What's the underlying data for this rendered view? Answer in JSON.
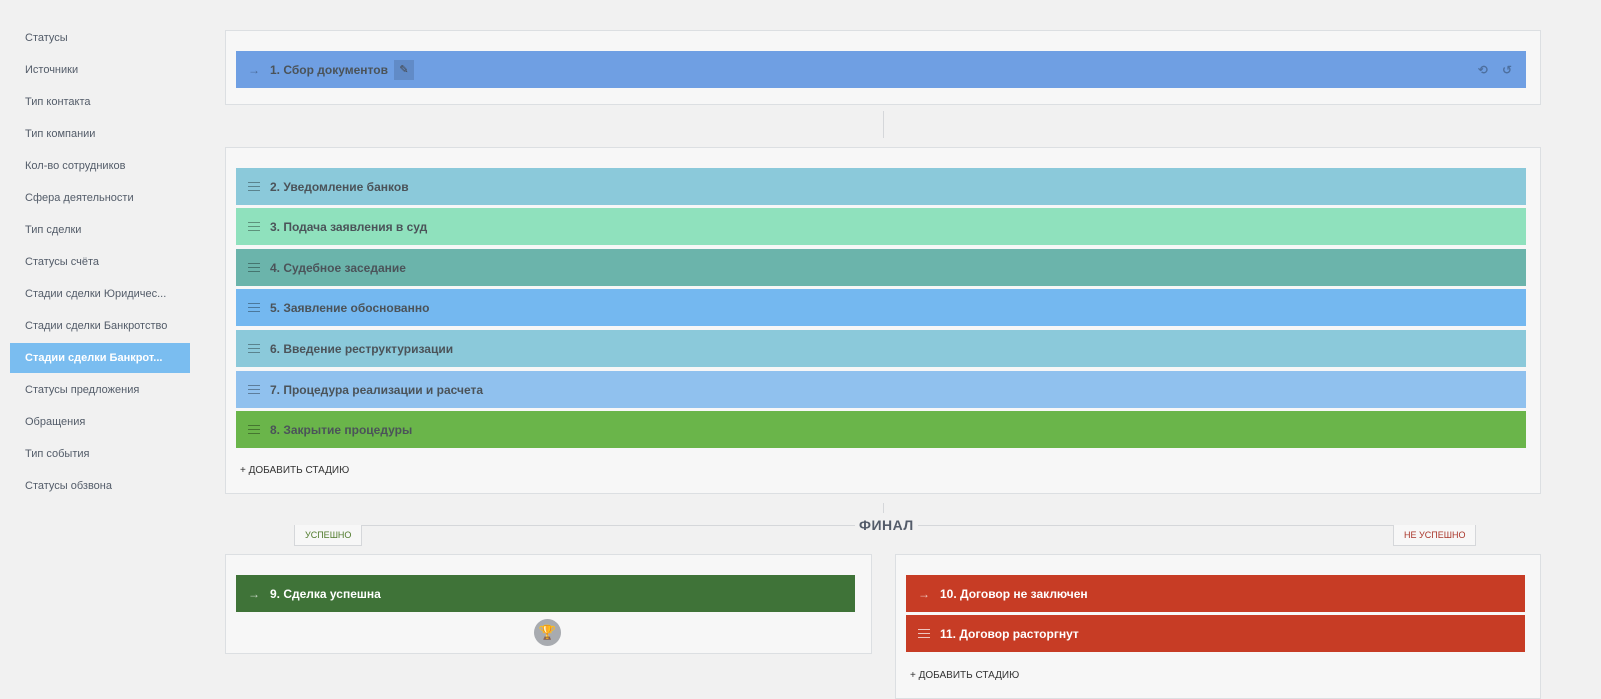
{
  "sidebar": {
    "items": [
      {
        "label": "Статусы"
      },
      {
        "label": "Источники"
      },
      {
        "label": "Тип контакта"
      },
      {
        "label": "Тип компании"
      },
      {
        "label": "Кол-во сотрудников"
      },
      {
        "label": "Сфера деятельности"
      },
      {
        "label": "Тип сделки"
      },
      {
        "label": "Статусы счёта"
      },
      {
        "label": "Стадии сделки Юридичес..."
      },
      {
        "label": "Стадии сделки Банкротство"
      },
      {
        "label": "Стадии сделки Банкрот...",
        "active": true
      },
      {
        "label": "Статусы предложения"
      },
      {
        "label": "Обращения"
      },
      {
        "label": "Тип события"
      },
      {
        "label": "Статусы обзвона"
      }
    ]
  },
  "first_stage": {
    "label": "1. Сбор документов",
    "color": "#6f9fe3"
  },
  "stages": [
    {
      "label": "2. Уведомление банков",
      "color": "#8bc9da"
    },
    {
      "label": "3. Подача заявления в суд",
      "color": "#8fe1bd"
    },
    {
      "label": "4. Судебное заседание",
      "color": "#6bb4ab"
    },
    {
      "label": "5. Заявление обоснованно",
      "color": "#74b8f0"
    },
    {
      "label": "6. Введение реструктуризации",
      "color": "#8bc9da"
    },
    {
      "label": "7. Процедура реализации и расчета",
      "color": "#90c1ee"
    },
    {
      "label": "8. Закрытие процедуры",
      "color": "#6ab54a"
    }
  ],
  "add_stage_label": "+ ДОБАВИТЬ СТАДИЮ",
  "final": {
    "title": "ФИНАЛ",
    "success_tab": "УСПЕШНО",
    "fail_tab": "НЕ УСПЕШНО",
    "success_stage": {
      "label": "9. Сделка успешна",
      "color": "#3f7338"
    },
    "fail_stages": [
      {
        "label": "10. Договор не заключен",
        "color": "#c73c25"
      },
      {
        "label": "11. Договор расторгнут",
        "color": "#c73c25"
      }
    ],
    "add_stage_label": "+ ДОБАВИТЬ СТАДИЮ"
  },
  "icons": {
    "arrow": "→",
    "edit": "✎",
    "refresh": "⟲",
    "reset": "↺",
    "trophy": "🏆"
  }
}
